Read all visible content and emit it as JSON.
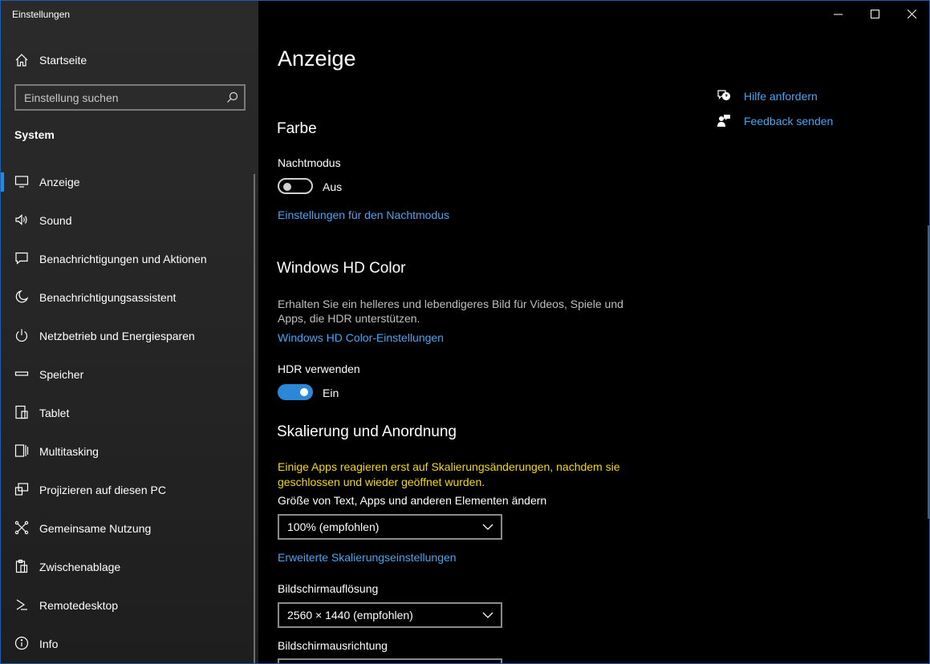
{
  "window": {
    "title": "Einstellungen"
  },
  "sidebar": {
    "home_label": "Startseite",
    "search_placeholder": "Einstellung suchen",
    "section": "System",
    "items": [
      {
        "label": "Anzeige",
        "icon": "monitor-icon",
        "selected": true
      },
      {
        "label": "Sound",
        "icon": "speaker-icon"
      },
      {
        "label": "Benachrichtigungen und Aktionen",
        "icon": "notification-icon"
      },
      {
        "label": "Benachrichtigungsassistent",
        "icon": "moon-icon"
      },
      {
        "label": "Netzbetrieb und Energiesparen",
        "icon": "power-icon"
      },
      {
        "label": "Speicher",
        "icon": "storage-icon"
      },
      {
        "label": "Tablet",
        "icon": "tablet-icon"
      },
      {
        "label": "Multitasking",
        "icon": "multitasking-icon"
      },
      {
        "label": "Projizieren auf diesen PC",
        "icon": "project-icon"
      },
      {
        "label": "Gemeinsame Nutzung",
        "icon": "share-icon"
      },
      {
        "label": "Zwischenablage",
        "icon": "clipboard-icon"
      },
      {
        "label": "Remotedesktop",
        "icon": "remote-icon"
      },
      {
        "label": "Info",
        "icon": "info-icon"
      }
    ]
  },
  "main": {
    "title": "Anzeige",
    "farbe": {
      "heading": "Farbe",
      "night_label": "Nachtmodus",
      "night_state": "Aus",
      "night_link": "Einstellungen für den Nachtmodus"
    },
    "hdr": {
      "heading": "Windows HD Color",
      "description": "Erhalten Sie ein helleres und lebendigeres Bild für Videos, Spiele und Apps, die HDR unterstützen.",
      "link": "Windows HD Color-Einstellungen",
      "toggle_label": "HDR verwenden",
      "toggle_state": "Ein"
    },
    "scale": {
      "heading": "Skalierung und Anordnung",
      "warning": "Einige Apps reagieren erst auf Skalierungsänderungen, nachdem sie geschlossen und wieder geöffnet wurden.",
      "size_label": "Größe von Text, Apps und anderen Elementen ändern",
      "size_value": "100% (empfohlen)",
      "advanced_link": "Erweiterte Skalierungseinstellungen",
      "resolution_label": "Bildschirmauflösung",
      "resolution_value": "2560 × 1440 (empfohlen)",
      "orientation_label": "Bildschirmausrichtung"
    },
    "help": {
      "get_help": "Hilfe anfordern",
      "feedback": "Feedback senden"
    }
  },
  "colors": {
    "accent": "#2b88d8",
    "link": "#4aa3f0",
    "warning": "#f3d90b"
  }
}
